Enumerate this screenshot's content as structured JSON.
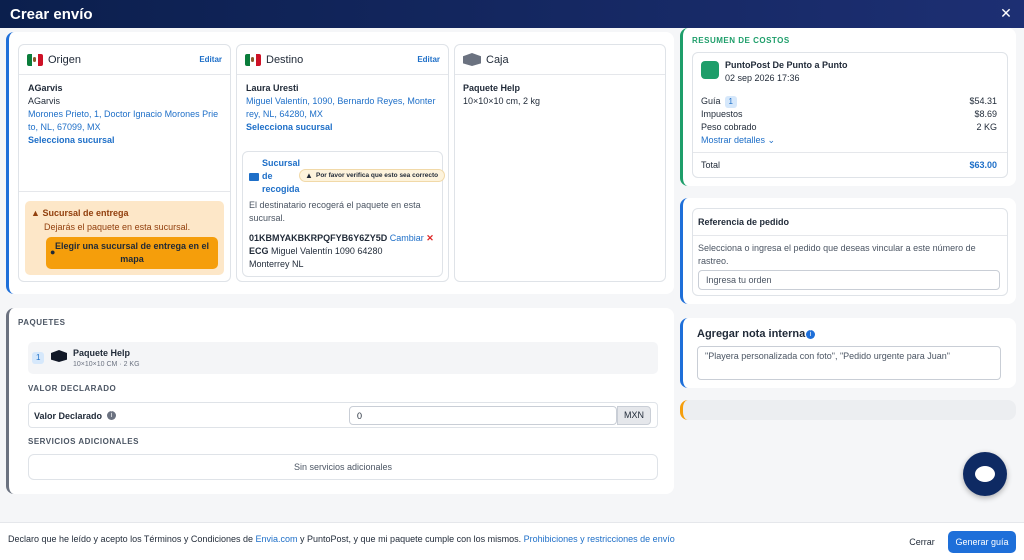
{
  "header": {
    "title": "Crear envío"
  },
  "origin": {
    "label": "Origen",
    "edit": "Editar",
    "name_bold": "AGarvis",
    "name": "AGarvis",
    "address": "Morones Prieto, 1, Doctor Ignacio Morones Prieto, NL, 67099, MX",
    "address_l1": "Morones Prieto, 1, Doctor Ignacio Morones Prie",
    "address_l2": "to, NL, 67099, MX",
    "select_branch": "Selecciona sucursal",
    "delivery_title": "Sucursal de entrega",
    "delivery_text": "Dejarás el paquete en esta sucursal.",
    "delivery_button": "Elegir una sucursal de entrega en el mapa",
    "delivery_button_l1": "Elegir una sucursal de entrega en el",
    "delivery_button_l2": "mapa"
  },
  "destination": {
    "label": "Destino",
    "edit": "Editar",
    "name": "Laura Uresti",
    "address_l1": "Miguel Valentín, 1090, Bernardo Reyes, Monter",
    "address_l2": "rey, NL, 64280, MX",
    "select_branch": "Selecciona sucursal",
    "pickup_title_l1": "Sucursal",
    "pickup_title_l2": "de",
    "pickup_title_l3": "recogida",
    "tooltip": "Por favor verifica que esto sea correcto",
    "pickup_desc_l1": "El destinatario recogerá el paquete en esta",
    "pickup_desc_l2": "sucursal.",
    "branch_code": "01KBMYAKBKRPQFYB6Y6ZY5D",
    "change": "Cambiar",
    "remove": "✕",
    "branch_name": "ECG",
    "branch_addr_l1": "Miguel Valentín 1090 64280",
    "branch_addr_l2": "Monterrey NL"
  },
  "box": {
    "label": "Caja",
    "package_name": "Paquete Help",
    "dims": "10×10×10 cm, 2 kg"
  },
  "packages": {
    "heading": "PAQUETES",
    "item_index": "1",
    "item_name": "Paquete Help",
    "item_dims": "10×10×10 CM · 2 KG",
    "declared_heading": "VALOR DECLARADO",
    "declared_label": "Valor Declarado",
    "declared_value": "0",
    "currency": "MXN",
    "services_heading": "SERVICIOS ADICIONALES",
    "services_empty": "Sin servicios adicionales"
  },
  "costs": {
    "heading": "RESUMEN DE COSTOS",
    "carrier": "PuntoPost De Punto a Punto",
    "date": "02 sep 2026 17:36",
    "guide_label": "Guía",
    "guide_count": "1",
    "guide_value": "$54.31",
    "tax_label": "Impuestos",
    "tax_value": "$8.69",
    "weight_label": "Peso cobrado",
    "weight_value": "2 KG",
    "details": "Mostrar detalles",
    "total_label": "Total",
    "total_value": "$63.00"
  },
  "order_ref": {
    "title": "Referencia de pedido",
    "desc_l1": "Selecciona o ingresa el pedido que deseas vincular a este número de",
    "desc_l2": "rastreo.",
    "placeholder": "Ingresa tu orden"
  },
  "note": {
    "title": "Agregar nota interna",
    "placeholder": "\"Playera personalizada con foto\", \"Pedido urgente para Juan\""
  },
  "footer": {
    "terms_prefix": "Declaro que he leído y acepto los Términos y Condiciones de ",
    "terms_link1": "Envia.com",
    "terms_middle": " y PuntoPost, y que mi paquete cumple con los mismos. ",
    "terms_link2": "Prohibiciones y restricciones de envío",
    "close": "Cerrar",
    "generate": "Generar guía"
  },
  "colors": {
    "brand_dark": "#0b1f4d",
    "primary": "#1e6fd9",
    "link": "#1e6fc8",
    "success": "#1e9e6a",
    "warning": "#f59e0b"
  }
}
